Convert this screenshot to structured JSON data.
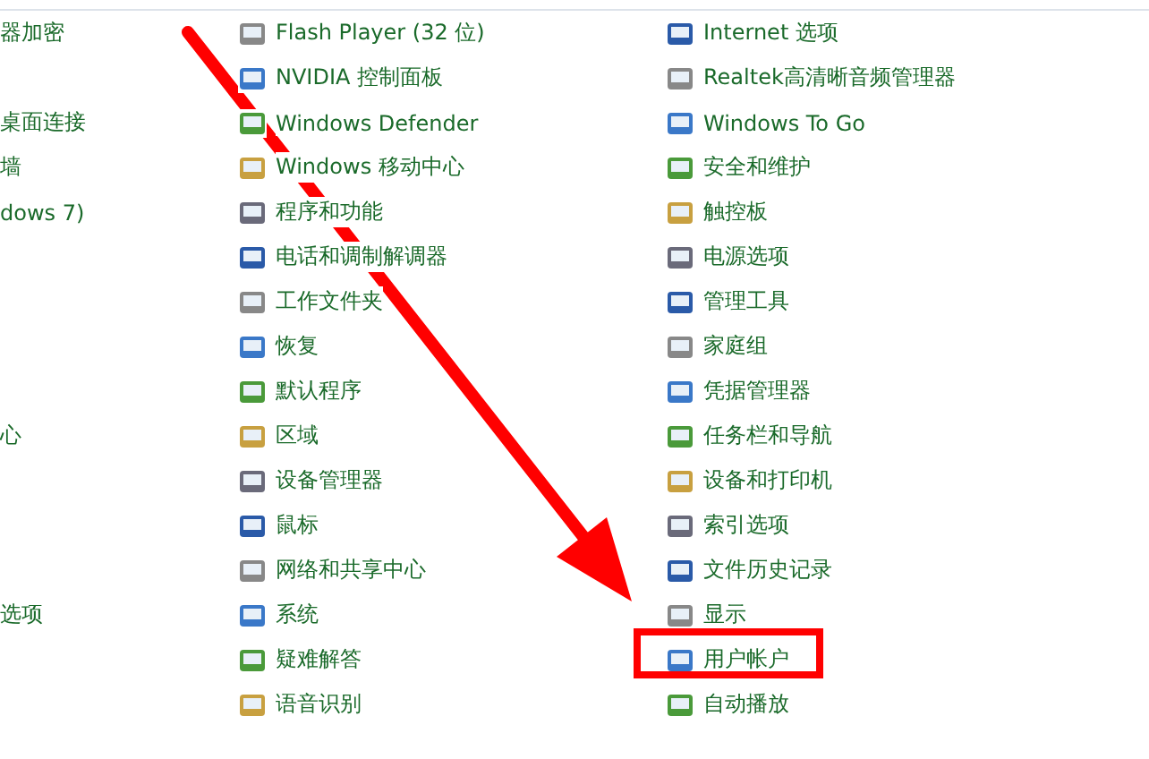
{
  "columns": [
    {
      "items": [
        {
          "label": "器加密",
          "highlighted": false
        },
        {
          "highlighted": false
        },
        {
          "label": "桌面连接",
          "highlighted": false
        },
        {
          "label": "墙",
          "highlighted": false
        },
        {
          "label": "dows 7)",
          "highlighted": false
        },
        {
          "highlighted": false
        },
        {
          "highlighted": false
        },
        {
          "highlighted": false
        },
        {
          "highlighted": false
        },
        {
          "label": "心",
          "highlighted": false
        },
        {
          "highlighted": false
        },
        {
          "highlighted": false
        },
        {
          "highlighted": false
        },
        {
          "label": "选项",
          "highlighted": false
        }
      ]
    },
    {
      "items": [
        {
          "label": "Flash Player (32 位)",
          "highlighted": false
        },
        {
          "label": "NVIDIA 控制面板",
          "highlighted": false
        },
        {
          "label": "Windows Defender",
          "highlighted": false
        },
        {
          "label": "Windows 移动中心",
          "highlighted": false
        },
        {
          "label": "程序和功能",
          "highlighted": false
        },
        {
          "label": "电话和调制解调器",
          "highlighted": false
        },
        {
          "label": "工作文件夹",
          "highlighted": false
        },
        {
          "label": "恢复",
          "highlighted": false
        },
        {
          "label": "默认程序",
          "highlighted": false
        },
        {
          "label": "区域",
          "highlighted": false
        },
        {
          "label": "设备管理器",
          "highlighted": false
        },
        {
          "label": "鼠标",
          "highlighted": false
        },
        {
          "label": "网络和共享中心",
          "highlighted": false
        },
        {
          "label": "系统",
          "highlighted": false
        },
        {
          "label": "疑难解答",
          "highlighted": false
        },
        {
          "label": "语音识别",
          "highlighted": false
        }
      ]
    },
    {
      "items": [
        {
          "label": "Internet 选项",
          "highlighted": false
        },
        {
          "label": "Realtek高清晰音频管理器",
          "highlighted": false
        },
        {
          "label": "Windows To Go",
          "highlighted": false
        },
        {
          "label": "安全和维护",
          "highlighted": false
        },
        {
          "label": "触控板",
          "highlighted": false
        },
        {
          "label": "电源选项",
          "highlighted": false
        },
        {
          "label": "管理工具",
          "highlighted": false
        },
        {
          "label": "家庭组",
          "highlighted": false
        },
        {
          "label": "凭据管理器",
          "highlighted": false
        },
        {
          "label": "任务栏和导航",
          "highlighted": false
        },
        {
          "label": "设备和打印机",
          "highlighted": false
        },
        {
          "label": "索引选项",
          "highlighted": false
        },
        {
          "label": "文件历史记录",
          "highlighted": false
        },
        {
          "label": "显示",
          "highlighted": false
        },
        {
          "label": "用户帐户",
          "highlighted": true
        },
        {
          "label": "自动播放",
          "highlighted": false
        }
      ]
    }
  ]
}
